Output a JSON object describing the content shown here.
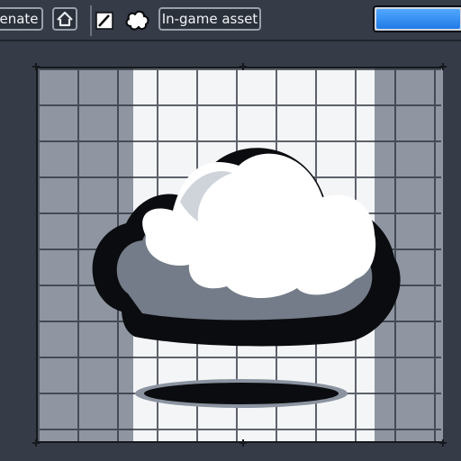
{
  "toolbar": {
    "generate_label": "enate",
    "asset_label": "In-game asset",
    "progress_fraction": 0.95
  },
  "colors": {
    "accent": "#2f8cf0",
    "panel": "#353b47",
    "canvas_bg": "#cbd0d8",
    "cloud": "#ffffff",
    "cloud_shadow": "#6f7785",
    "outline": "#0b0c0f"
  }
}
